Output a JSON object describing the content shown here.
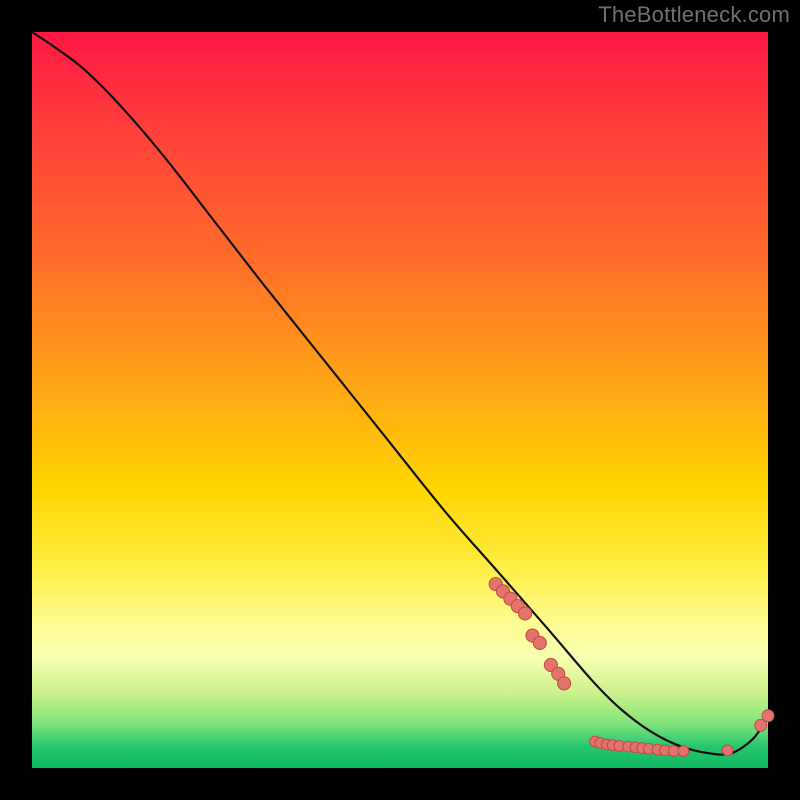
{
  "watermark": "TheBottleneck.com",
  "colors": {
    "background": "#000000",
    "curve": "#111111",
    "dot_fill": "#e4736b",
    "dot_stroke": "#c04b44",
    "gradient_top": "#ff1744",
    "gradient_bottom": "#0fb862"
  },
  "chart_data": {
    "type": "line",
    "title": "",
    "xlabel": "",
    "ylabel": "",
    "xlim": [
      0,
      100
    ],
    "ylim": [
      0,
      100
    ],
    "x": [
      0,
      3,
      7,
      12,
      18,
      25,
      32,
      40,
      48,
      56,
      63,
      70,
      76,
      80,
      84,
      88,
      92,
      95,
      98,
      100
    ],
    "values": [
      100,
      98,
      95,
      90,
      83,
      74,
      65,
      55,
      45,
      35,
      27,
      19,
      12,
      8,
      5,
      3,
      2,
      2,
      4,
      7
    ],
    "scatter_points": [
      {
        "x": 63,
        "y": 25,
        "r": 1.1
      },
      {
        "x": 64,
        "y": 24,
        "r": 1.1
      },
      {
        "x": 65,
        "y": 23,
        "r": 1.1
      },
      {
        "x": 66,
        "y": 22,
        "r": 1.1
      },
      {
        "x": 67,
        "y": 21,
        "r": 1.1
      },
      {
        "x": 68,
        "y": 18,
        "r": 1.1
      },
      {
        "x": 69,
        "y": 17,
        "r": 1.1
      },
      {
        "x": 70.5,
        "y": 14,
        "r": 1.1
      },
      {
        "x": 71.5,
        "y": 12.8,
        "r": 1.1
      },
      {
        "x": 72.3,
        "y": 11.5,
        "r": 1.1
      },
      {
        "x": 76.5,
        "y": 3.6,
        "r": 0.9
      },
      {
        "x": 77.2,
        "y": 3.4,
        "r": 0.9
      },
      {
        "x": 78.1,
        "y": 3.2,
        "r": 0.9
      },
      {
        "x": 78.9,
        "y": 3.1,
        "r": 0.9
      },
      {
        "x": 79.8,
        "y": 3.0,
        "r": 0.9
      },
      {
        "x": 81.0,
        "y": 2.9,
        "r": 0.9
      },
      {
        "x": 82.0,
        "y": 2.8,
        "r": 0.9
      },
      {
        "x": 82.9,
        "y": 2.7,
        "r": 0.9
      },
      {
        "x": 83.8,
        "y": 2.6,
        "r": 0.9
      },
      {
        "x": 85.0,
        "y": 2.5,
        "r": 0.9
      },
      {
        "x": 86.0,
        "y": 2.4,
        "r": 0.9
      },
      {
        "x": 87.2,
        "y": 2.3,
        "r": 0.9
      },
      {
        "x": 88.5,
        "y": 2.3,
        "r": 0.9
      },
      {
        "x": 94.5,
        "y": 2.4,
        "r": 0.9
      },
      {
        "x": 99.0,
        "y": 5.8,
        "r": 1.0
      },
      {
        "x": 100.0,
        "y": 7.1,
        "r": 1.0
      }
    ]
  }
}
